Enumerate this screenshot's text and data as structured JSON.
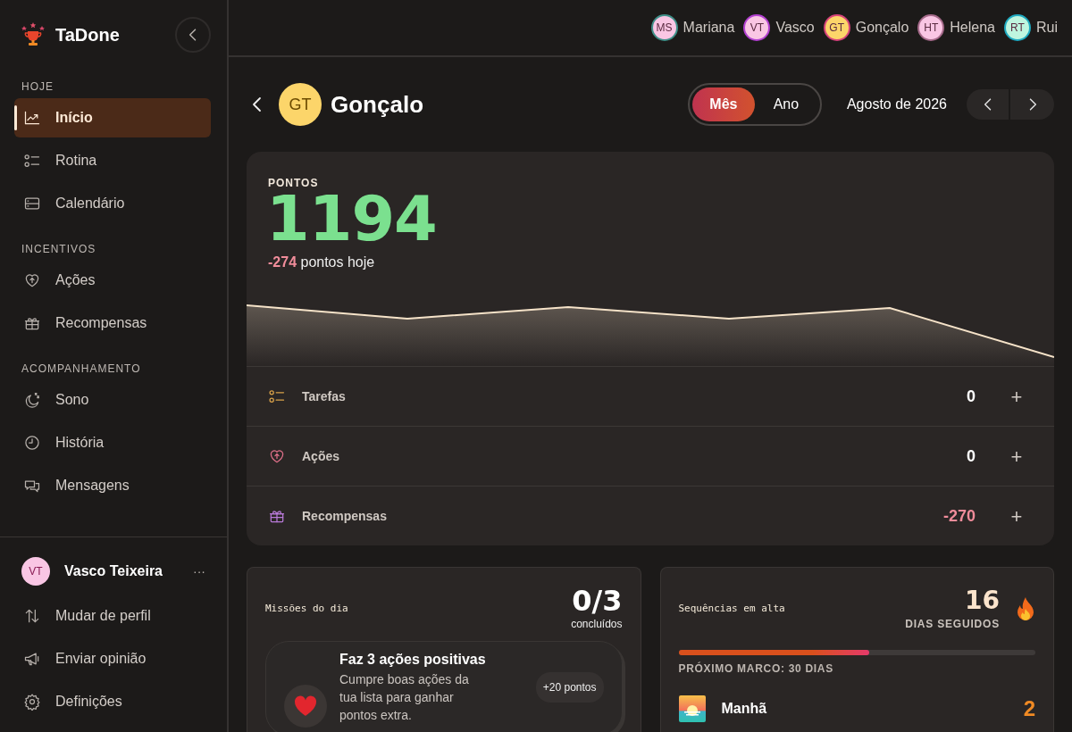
{
  "app": {
    "name": "TaDone"
  },
  "sidebar": {
    "sections": [
      {
        "title": "HOJE",
        "items": [
          {
            "label": "Início",
            "kind": "chart",
            "selected": true
          },
          {
            "label": "Rotina",
            "kind": "checklist",
            "selected": false
          },
          {
            "label": "Calendário",
            "kind": "calendar",
            "selected": false
          }
        ]
      },
      {
        "title": "INCENTIVOS",
        "items": [
          {
            "label": "Ações",
            "kind": "heart",
            "selected": false
          },
          {
            "label": "Recompensas",
            "kind": "gift",
            "selected": false
          }
        ]
      },
      {
        "title": "ACOMPANHAMENTO",
        "items": [
          {
            "label": "Sono",
            "kind": "moon",
            "selected": false
          },
          {
            "label": "História",
            "kind": "clock",
            "selected": false
          },
          {
            "label": "Mensagens",
            "kind": "chat",
            "selected": false
          }
        ]
      }
    ],
    "user": {
      "initials": "VT",
      "name": "Vasco Teixeira",
      "menu": "···",
      "color": "#f9c6e4"
    },
    "footer_items": [
      {
        "label": "Mudar de perfil",
        "kind": "swap"
      },
      {
        "label": "Enviar opinião",
        "kind": "megaphone"
      },
      {
        "label": "Definições",
        "kind": "gear"
      }
    ]
  },
  "members": [
    {
      "initials": "MS",
      "name": "Mariana",
      "color": "#f9c6e4"
    },
    {
      "initials": "VT",
      "name": "Vasco",
      "color": "#f9c6e4"
    },
    {
      "initials": "GT",
      "name": "Gonçalo",
      "color": "#fcd56a"
    },
    {
      "initials": "HT",
      "name": "Helena",
      "color": "#f9c6e4"
    },
    {
      "initials": "RT",
      "name": "Rui",
      "color": "#bff5df"
    }
  ],
  "profile": {
    "initials": "GT",
    "name": "Gonçalo",
    "color": "#fcd56a"
  },
  "period_tabs": [
    {
      "label": "Mês",
      "selected": true
    },
    {
      "label": "Ano",
      "selected": false
    }
  ],
  "period_label": "Agosto de 2026",
  "points": {
    "label": "PONTOS",
    "value": "1194",
    "today_delta": "-274",
    "today_label": "pontos hoje",
    "rows": [
      {
        "label": "Tarefas",
        "kind": "checklist",
        "value": "0",
        "negative": false,
        "add": "+"
      },
      {
        "label": "Ações",
        "kind": "heart",
        "value": "0",
        "negative": false,
        "add": "+"
      },
      {
        "label": "Recompensas",
        "kind": "gift",
        "value": "-270",
        "negative": true,
        "add": "+"
      }
    ]
  },
  "missions": {
    "title": "Missões do dia",
    "count": "0/3",
    "count_label": "concluídos",
    "items": [
      {
        "title": "Faz 3 ações positivas",
        "description": "Cumpre boas ações da tua lista para ganhar pontos extra.",
        "reward": "+20 pontos"
      }
    ]
  },
  "streak": {
    "title": "Sequências em alta",
    "days": "16",
    "days_label": "DIAS SEGUIDOS",
    "level": 0.535,
    "milestone": "PRÓXIMO MARCO: 30 DIAS",
    "items": [
      {
        "label": "Manhã",
        "value": "2"
      }
    ]
  }
}
